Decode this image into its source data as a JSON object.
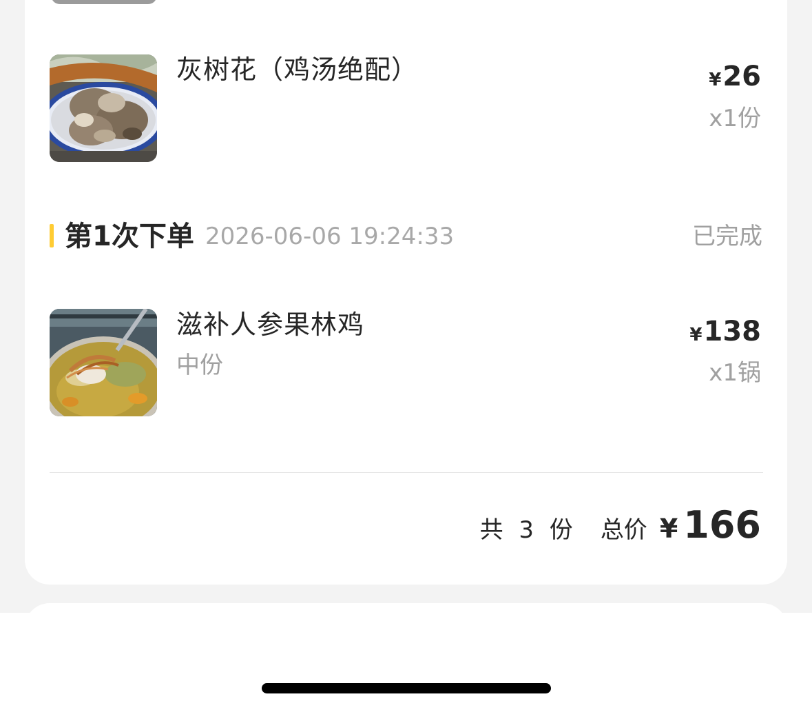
{
  "items_before": [
    {
      "name": "灰树花（鸡汤绝配）",
      "spec": "",
      "yen": "¥",
      "price": "26",
      "qty": "x1份",
      "image": "maitake-mushroom-photo"
    }
  ],
  "order": {
    "title": "第1次下单",
    "time": "2026-06-06 19:24:33",
    "status": "已完成",
    "items": [
      {
        "name": "滋补人参果林鸡",
        "spec": "中份",
        "yen": "¥",
        "price": "138",
        "qty": "x1锅",
        "image": "ginseng-chicken-soup-photo"
      }
    ]
  },
  "summary": {
    "count_text": "共 3 份",
    "total_label": "总价",
    "yen": "¥",
    "total": "166"
  },
  "colors": {
    "accent_bar": "#ffcc33",
    "text_primary": "#262626",
    "text_secondary": "#a0a0a0",
    "background": "#f3f3f3",
    "card": "#ffffff"
  }
}
